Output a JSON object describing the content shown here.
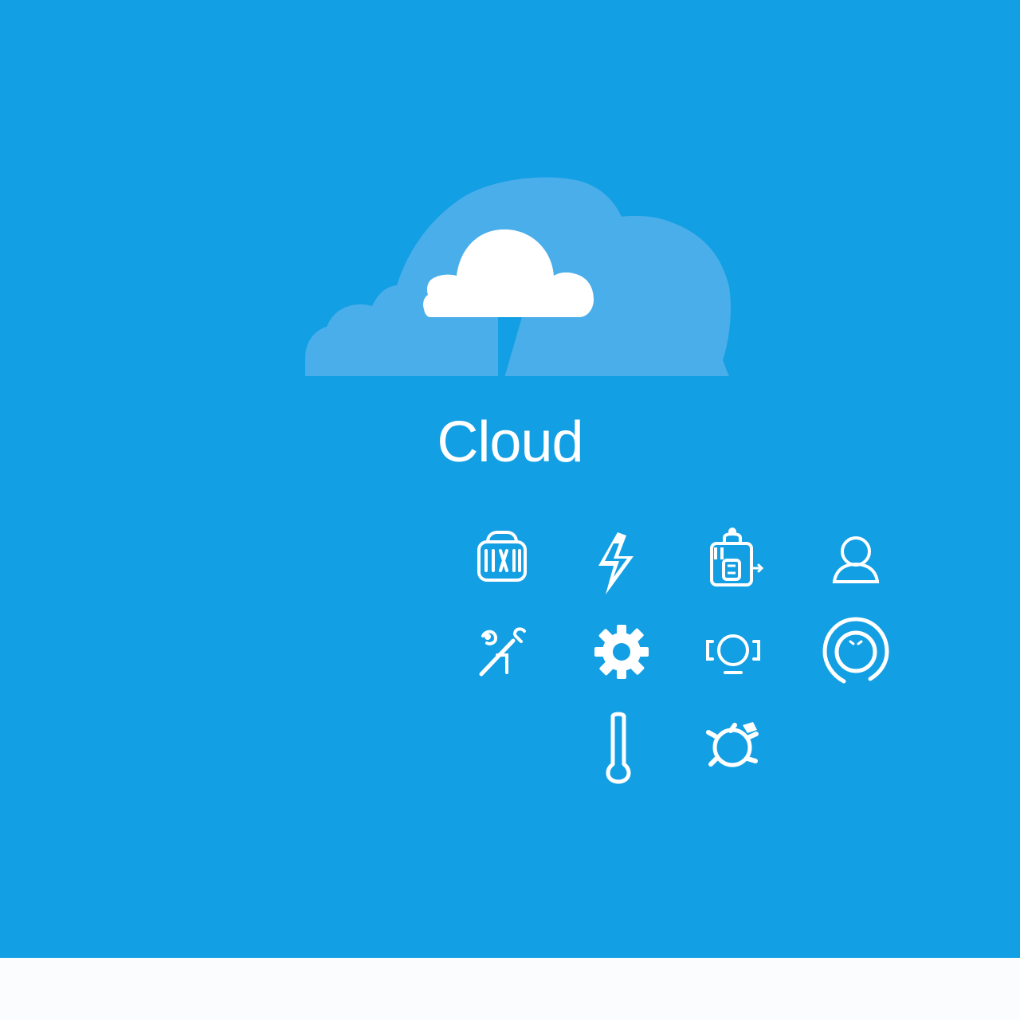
{
  "screen": {
    "title": "Cloud",
    "background_color": "#129fe4",
    "footer_color": "#fbfcfd"
  },
  "hero": {
    "icon": "cloud-icon"
  },
  "icons": [
    {
      "name": "server-rack-icon"
    },
    {
      "name": "lightning-bolt-icon"
    },
    {
      "name": "lock-icon"
    },
    {
      "name": "user-icon"
    },
    {
      "name": "tools-icon"
    },
    {
      "name": "gear-icon"
    },
    {
      "name": "camera-icon"
    },
    {
      "name": "target-icon"
    },
    {
      "name": "thermometer-icon"
    },
    {
      "name": "bug-icon"
    }
  ]
}
